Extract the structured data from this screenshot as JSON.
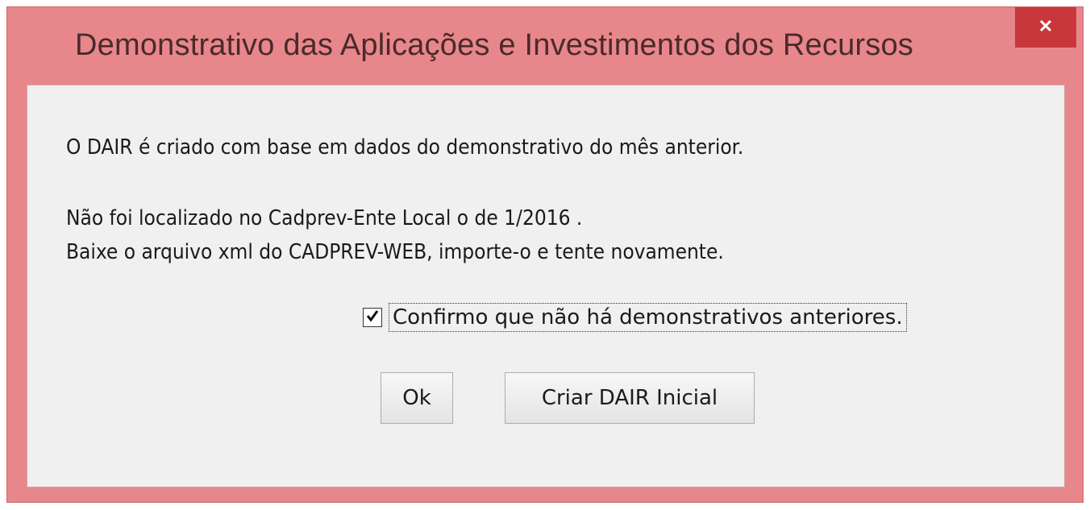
{
  "window": {
    "title": "Demonstrativo das Aplicações e Investimentos dos Recursos",
    "close_label": "×",
    "accent_color": "#e8878b",
    "close_color": "#c7373c"
  },
  "message": {
    "line1": "O DAIR é criado com base em dados do demonstrativo do mês anterior.",
    "line2": "Não foi localizado no Cadprev-Ente Local o de 1/2016 .",
    "line3": "Baixe o arquivo xml do CADPREV-WEB, importe-o e tente novamente."
  },
  "confirm": {
    "label": "Confirmo que não há demonstrativos anteriores.",
    "checked": true
  },
  "buttons": {
    "ok": "Ok",
    "create": "Criar DAIR Inicial"
  }
}
